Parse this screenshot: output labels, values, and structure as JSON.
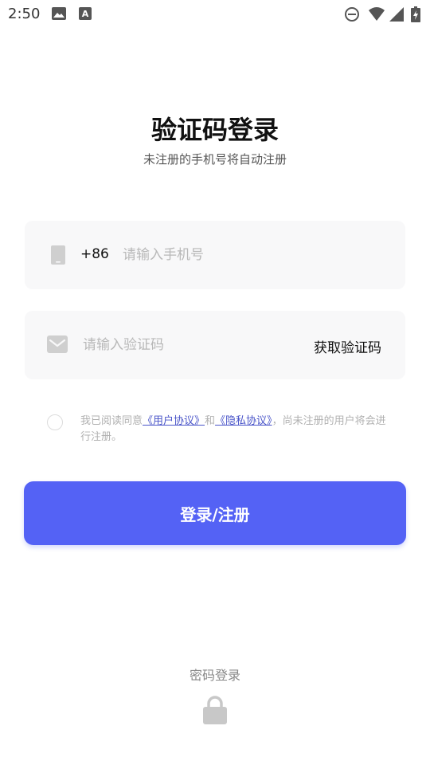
{
  "status_bar": {
    "time": "2:50",
    "icons": [
      "image-icon",
      "font-a-icon",
      "do-not-disturb-icon",
      "wifi-icon",
      "signal-icon",
      "battery-icon"
    ]
  },
  "header": {
    "title": "验证码登录",
    "subtitle": "未注册的手机号将自动注册"
  },
  "phone_field": {
    "icon": "phone-icon",
    "prefix": "+86",
    "value": "",
    "placeholder": "请输入手机号"
  },
  "code_field": {
    "icon": "mail-icon",
    "value": "",
    "placeholder": "请输入验证码",
    "get_code_label": "获取验证码"
  },
  "agreement": {
    "checked": false,
    "prefix": "我已阅读同意",
    "user_agreement": "《用户协议》",
    "and": "和",
    "privacy_policy": "《隐私协议》",
    "suffix": "，尚未注册的用户将会进行注册。"
  },
  "login_button": {
    "label": "登录/注册"
  },
  "password_login": {
    "label": "密码登录",
    "icon": "lock-icon"
  },
  "colors": {
    "accent": "#5462f5",
    "link": "#4a55c9",
    "field_background": "#f8f8f9",
    "placeholder": "#b8b8b8"
  }
}
